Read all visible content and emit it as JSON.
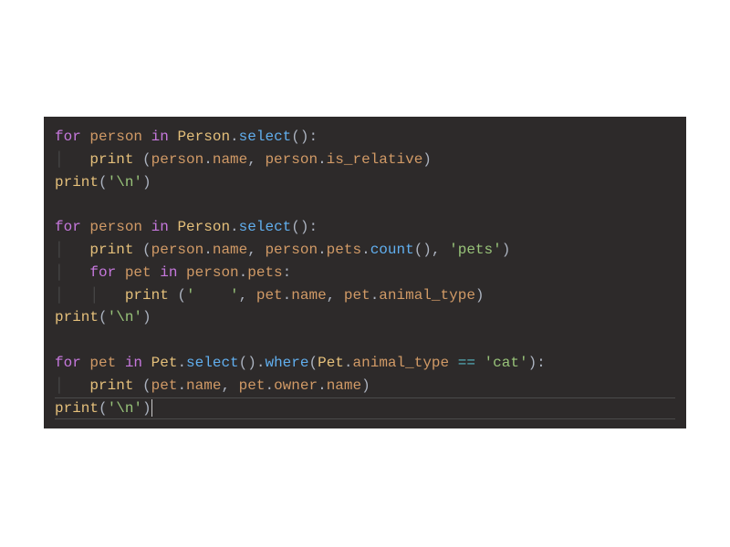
{
  "code": {
    "lines": [
      {
        "tokens": [
          {
            "t": "for ",
            "c": "kw-for"
          },
          {
            "t": "person ",
            "c": "var"
          },
          {
            "t": "in ",
            "c": "kw-in"
          },
          {
            "t": "Person",
            "c": "class"
          },
          {
            "t": ".",
            "c": "dot"
          },
          {
            "t": "select",
            "c": "method"
          },
          {
            "t": "():",
            "c": "punct"
          }
        ]
      },
      {
        "indent": 1,
        "tokens": [
          {
            "t": "print",
            "c": "func"
          },
          {
            "t": " (",
            "c": "punct"
          },
          {
            "t": "person",
            "c": "var"
          },
          {
            "t": ".",
            "c": "dot"
          },
          {
            "t": "name",
            "c": "var"
          },
          {
            "t": ", ",
            "c": "punct"
          },
          {
            "t": "person",
            "c": "var"
          },
          {
            "t": ".",
            "c": "dot"
          },
          {
            "t": "is_relative",
            "c": "var"
          },
          {
            "t": ")",
            "c": "punct"
          }
        ]
      },
      {
        "tokens": [
          {
            "t": "print",
            "c": "func"
          },
          {
            "t": "(",
            "c": "punct"
          },
          {
            "t": "'\\n'",
            "c": "string"
          },
          {
            "t": ")",
            "c": "punct"
          }
        ]
      },
      {
        "tokens": []
      },
      {
        "tokens": [
          {
            "t": "for ",
            "c": "kw-for"
          },
          {
            "t": "person ",
            "c": "var"
          },
          {
            "t": "in ",
            "c": "kw-in"
          },
          {
            "t": "Person",
            "c": "class"
          },
          {
            "t": ".",
            "c": "dot"
          },
          {
            "t": "select",
            "c": "method"
          },
          {
            "t": "():",
            "c": "punct"
          }
        ]
      },
      {
        "indent": 1,
        "tokens": [
          {
            "t": "print",
            "c": "func"
          },
          {
            "t": " (",
            "c": "punct"
          },
          {
            "t": "person",
            "c": "var"
          },
          {
            "t": ".",
            "c": "dot"
          },
          {
            "t": "name",
            "c": "var"
          },
          {
            "t": ", ",
            "c": "punct"
          },
          {
            "t": "person",
            "c": "var"
          },
          {
            "t": ".",
            "c": "dot"
          },
          {
            "t": "pets",
            "c": "var"
          },
          {
            "t": ".",
            "c": "dot"
          },
          {
            "t": "count",
            "c": "method"
          },
          {
            "t": "(), ",
            "c": "punct"
          },
          {
            "t": "'pets'",
            "c": "string"
          },
          {
            "t": ")",
            "c": "punct"
          }
        ]
      },
      {
        "indent": 1,
        "tokens": [
          {
            "t": "for ",
            "c": "kw-for"
          },
          {
            "t": "pet ",
            "c": "var"
          },
          {
            "t": "in ",
            "c": "kw-in"
          },
          {
            "t": "person",
            "c": "var"
          },
          {
            "t": ".",
            "c": "dot"
          },
          {
            "t": "pets",
            "c": "var"
          },
          {
            "t": ":",
            "c": "punct"
          }
        ]
      },
      {
        "indent": 2,
        "tokens": [
          {
            "t": "print",
            "c": "func"
          },
          {
            "t": " (",
            "c": "punct"
          },
          {
            "t": "'    '",
            "c": "string"
          },
          {
            "t": ", ",
            "c": "punct"
          },
          {
            "t": "pet",
            "c": "var"
          },
          {
            "t": ".",
            "c": "dot"
          },
          {
            "t": "name",
            "c": "var"
          },
          {
            "t": ", ",
            "c": "punct"
          },
          {
            "t": "pet",
            "c": "var"
          },
          {
            "t": ".",
            "c": "dot"
          },
          {
            "t": "animal_type",
            "c": "var"
          },
          {
            "t": ")",
            "c": "punct"
          }
        ]
      },
      {
        "tokens": [
          {
            "t": "print",
            "c": "func"
          },
          {
            "t": "(",
            "c": "punct"
          },
          {
            "t": "'\\n'",
            "c": "string"
          },
          {
            "t": ")",
            "c": "punct"
          }
        ]
      },
      {
        "tokens": []
      },
      {
        "tokens": [
          {
            "t": "for ",
            "c": "kw-for"
          },
          {
            "t": "pet ",
            "c": "var"
          },
          {
            "t": "in ",
            "c": "kw-in"
          },
          {
            "t": "Pet",
            "c": "class"
          },
          {
            "t": ".",
            "c": "dot"
          },
          {
            "t": "select",
            "c": "method"
          },
          {
            "t": "().",
            "c": "punct"
          },
          {
            "t": "where",
            "c": "method"
          },
          {
            "t": "(",
            "c": "punct"
          },
          {
            "t": "Pet",
            "c": "class"
          },
          {
            "t": ".",
            "c": "dot"
          },
          {
            "t": "animal_type",
            "c": "var"
          },
          {
            "t": " == ",
            "c": "op"
          },
          {
            "t": "'cat'",
            "c": "string"
          },
          {
            "t": "):",
            "c": "punct"
          }
        ]
      },
      {
        "indent": 1,
        "tokens": [
          {
            "t": "print",
            "c": "func"
          },
          {
            "t": " (",
            "c": "punct"
          },
          {
            "t": "pet",
            "c": "var"
          },
          {
            "t": ".",
            "c": "dot"
          },
          {
            "t": "name",
            "c": "var"
          },
          {
            "t": ", ",
            "c": "punct"
          },
          {
            "t": "pet",
            "c": "var"
          },
          {
            "t": ".",
            "c": "dot"
          },
          {
            "t": "owner",
            "c": "var"
          },
          {
            "t": ".",
            "c": "dot"
          },
          {
            "t": "name",
            "c": "var"
          },
          {
            "t": ")",
            "c": "punct"
          }
        ]
      },
      {
        "cursor_line": true,
        "tokens": [
          {
            "t": "print",
            "c": "func"
          },
          {
            "t": "(",
            "c": "punct"
          },
          {
            "t": "'\\n'",
            "c": "string"
          },
          {
            "t": ")",
            "c": "punct"
          }
        ],
        "cursor_after": true
      }
    ]
  }
}
